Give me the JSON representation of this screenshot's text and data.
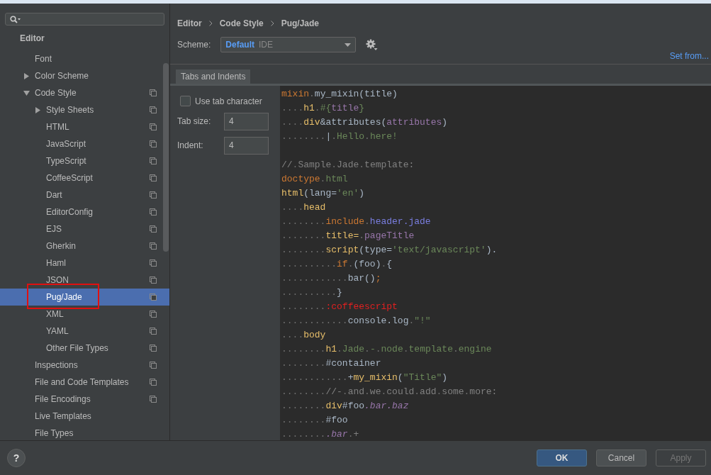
{
  "sidebar": {
    "header": "Editor",
    "items": [
      {
        "label": "Font",
        "selected": false,
        "copy_icon": false,
        "marked": false
      },
      {
        "label": "Color Scheme",
        "selected": false,
        "copy_icon": false,
        "marked": false,
        "expanded": false
      },
      {
        "label": "Code Style",
        "selected": false,
        "copy_icon": true,
        "marked": false,
        "expanded": true,
        "children": [
          {
            "label": "Style Sheets",
            "selected": false,
            "copy_icon": true,
            "marked": false,
            "expanded": false
          },
          {
            "label": "HTML",
            "selected": false,
            "copy_icon": true,
            "marked": false
          },
          {
            "label": "JavaScript",
            "selected": false,
            "copy_icon": true,
            "marked": false
          },
          {
            "label": "TypeScript",
            "selected": false,
            "copy_icon": true,
            "marked": false
          },
          {
            "label": "CoffeeScript",
            "selected": false,
            "copy_icon": true,
            "marked": false
          },
          {
            "label": "Dart",
            "selected": false,
            "copy_icon": true,
            "marked": false
          },
          {
            "label": "EditorConfig",
            "selected": false,
            "copy_icon": true,
            "marked": false
          },
          {
            "label": "EJS",
            "selected": false,
            "copy_icon": true,
            "marked": false
          },
          {
            "label": "Gherkin",
            "selected": false,
            "copy_icon": true,
            "marked": false
          },
          {
            "label": "Haml",
            "selected": false,
            "copy_icon": true,
            "marked": false
          },
          {
            "label": "JSON",
            "selected": false,
            "copy_icon": true,
            "marked": false
          },
          {
            "label": "Pug/Jade",
            "selected": true,
            "copy_icon": true,
            "marked": true
          },
          {
            "label": "XML",
            "selected": false,
            "copy_icon": true,
            "marked": false
          },
          {
            "label": "YAML",
            "selected": false,
            "copy_icon": true,
            "marked": false
          },
          {
            "label": "Other File Types",
            "selected": false,
            "copy_icon": true,
            "marked": false
          }
        ]
      },
      {
        "label": "Inspections",
        "selected": false,
        "copy_icon": true,
        "marked": false
      },
      {
        "label": "File and Code Templates",
        "selected": false,
        "copy_icon": true,
        "marked": false
      },
      {
        "label": "File Encodings",
        "selected": false,
        "copy_icon": true,
        "marked": false
      },
      {
        "label": "Live Templates",
        "selected": false,
        "copy_icon": false,
        "marked": false
      },
      {
        "label": "File Types",
        "selected": false,
        "copy_icon": false,
        "marked": false
      }
    ]
  },
  "breadcrumb": [
    "Editor",
    "Code Style",
    "Pug/Jade"
  ],
  "scheme": {
    "label": "Scheme:",
    "name": "Default",
    "scope": "IDE"
  },
  "set_from": "Set from...",
  "tabs": [
    {
      "label": "Tabs and Indents",
      "selected": true
    }
  ],
  "options": {
    "use_tab": {
      "label": "Use tab character",
      "checked": false
    },
    "fields": [
      {
        "label": "Tab size:",
        "value": "4"
      },
      {
        "label": "Indent:",
        "value": "4"
      }
    ]
  },
  "code": [
    {
      "kind": "code",
      "tokens": [
        {
          "kind": "kw",
          "text": "mixin"
        },
        {
          "kind": "ws",
          "text": "."
        },
        {
          "kind": "plain",
          "text": "my_mixin(title)"
        }
      ]
    },
    {
      "kind": "code",
      "tokens": [
        {
          "kind": "ws",
          "text": "...."
        },
        {
          "kind": "tag",
          "text": "h1"
        },
        {
          "kind": "ws",
          "text": "."
        },
        {
          "kind": "str",
          "text": "#{"
        },
        {
          "kind": "var",
          "text": "title"
        },
        {
          "kind": "str",
          "text": "}"
        }
      ]
    },
    {
      "kind": "code",
      "tokens": [
        {
          "kind": "ws",
          "text": "...."
        },
        {
          "kind": "tag",
          "text": "div"
        },
        {
          "kind": "plain",
          "text": "&attributes("
        },
        {
          "kind": "var",
          "text": "attributes"
        },
        {
          "kind": "plain",
          "text": ")"
        }
      ]
    },
    {
      "kind": "code",
      "tokens": [
        {
          "kind": "ws",
          "text": "........"
        },
        {
          "kind": "plain",
          "text": "|"
        },
        {
          "kind": "ws",
          "text": "."
        },
        {
          "kind": "str",
          "text": "Hello"
        },
        {
          "kind": "ws",
          "text": "."
        },
        {
          "kind": "str",
          "text": "here!"
        }
      ]
    },
    {
      "kind": "blank"
    },
    {
      "kind": "code",
      "tokens": [
        {
          "kind": "comment",
          "text": "//"
        },
        {
          "kind": "ws",
          "text": "."
        },
        {
          "kind": "comment",
          "text": "Sample"
        },
        {
          "kind": "ws",
          "text": "."
        },
        {
          "kind": "comment",
          "text": "Jade"
        },
        {
          "kind": "ws",
          "text": "."
        },
        {
          "kind": "comment",
          "text": "template:"
        }
      ]
    },
    {
      "kind": "code",
      "tokens": [
        {
          "kind": "kw",
          "text": "doctype"
        },
        {
          "kind": "ws",
          "text": "."
        },
        {
          "kind": "str",
          "text": "html"
        }
      ]
    },
    {
      "kind": "code",
      "tokens": [
        {
          "kind": "tag",
          "text": "html"
        },
        {
          "kind": "plain",
          "text": "(lang="
        },
        {
          "kind": "str",
          "text": "'en'"
        },
        {
          "kind": "plain",
          "text": ")"
        }
      ]
    },
    {
      "kind": "code",
      "tokens": [
        {
          "kind": "ws",
          "text": "...."
        },
        {
          "kind": "tag",
          "text": "head"
        }
      ]
    },
    {
      "kind": "code",
      "tokens": [
        {
          "kind": "ws",
          "text": "........"
        },
        {
          "kind": "kw",
          "text": "include"
        },
        {
          "kind": "ws",
          "text": "."
        },
        {
          "kind": "file",
          "text": "header.jade"
        }
      ]
    },
    {
      "kind": "code",
      "tokens": [
        {
          "kind": "ws",
          "text": "........"
        },
        {
          "kind": "tag",
          "text": "title="
        },
        {
          "kind": "ws",
          "text": "."
        },
        {
          "kind": "var",
          "text": "pageTitle"
        }
      ]
    },
    {
      "kind": "code",
      "tokens": [
        {
          "kind": "ws",
          "text": "........"
        },
        {
          "kind": "tag",
          "text": "script"
        },
        {
          "kind": "plain",
          "text": "(type="
        },
        {
          "kind": "str",
          "text": "'text/javascript'"
        },
        {
          "kind": "plain",
          "text": ")."
        }
      ]
    },
    {
      "kind": "code",
      "tokens": [
        {
          "kind": "ws",
          "text": ".........."
        },
        {
          "kind": "kw",
          "text": "if"
        },
        {
          "kind": "ws",
          "text": "."
        },
        {
          "kind": "plain",
          "text": "(foo)"
        },
        {
          "kind": "ws",
          "text": "."
        },
        {
          "kind": "plain",
          "text": "{"
        }
      ]
    },
    {
      "kind": "code",
      "tokens": [
        {
          "kind": "ws",
          "text": "............"
        },
        {
          "kind": "plain",
          "text": "bar()"
        },
        {
          "kind": "kw",
          "text": ";"
        }
      ]
    },
    {
      "kind": "code",
      "tokens": [
        {
          "kind": "ws",
          "text": ".........."
        },
        {
          "kind": "plain",
          "text": "}"
        }
      ]
    },
    {
      "kind": "code",
      "tokens": [
        {
          "kind": "ws",
          "text": "........"
        },
        {
          "kind": "filter",
          "text": ":coffeescript"
        }
      ]
    },
    {
      "kind": "code",
      "tokens": [
        {
          "kind": "ws",
          "text": "............"
        },
        {
          "kind": "plain",
          "text": "console.log"
        },
        {
          "kind": "ws",
          "text": "."
        },
        {
          "kind": "str",
          "text": "\"!\""
        }
      ]
    },
    {
      "kind": "code",
      "tokens": [
        {
          "kind": "ws",
          "text": "...."
        },
        {
          "kind": "tag",
          "text": "body"
        }
      ]
    },
    {
      "kind": "code",
      "tokens": [
        {
          "kind": "ws",
          "text": "........"
        },
        {
          "kind": "tag",
          "text": "h1"
        },
        {
          "kind": "ws",
          "text": "."
        },
        {
          "kind": "str",
          "text": "Jade"
        },
        {
          "kind": "ws",
          "text": "."
        },
        {
          "kind": "str",
          "text": "-"
        },
        {
          "kind": "ws",
          "text": "."
        },
        {
          "kind": "str",
          "text": "node"
        },
        {
          "kind": "ws",
          "text": "."
        },
        {
          "kind": "str",
          "text": "template"
        },
        {
          "kind": "ws",
          "text": "."
        },
        {
          "kind": "str",
          "text": "engine"
        }
      ]
    },
    {
      "kind": "code",
      "tokens": [
        {
          "kind": "ws",
          "text": "........"
        },
        {
          "kind": "plain",
          "text": "#container"
        }
      ]
    },
    {
      "kind": "code",
      "tokens": [
        {
          "kind": "ws",
          "text": "............"
        },
        {
          "kind": "plain",
          "text": "+"
        },
        {
          "kind": "tag",
          "text": "my_mixin"
        },
        {
          "kind": "plain",
          "text": "("
        },
        {
          "kind": "str",
          "text": "\"Title\""
        },
        {
          "kind": "plain",
          "text": ")"
        }
      ]
    },
    {
      "kind": "code",
      "tokens": [
        {
          "kind": "ws",
          "text": "........"
        },
        {
          "kind": "comment",
          "text": "//-"
        },
        {
          "kind": "ws",
          "text": "."
        },
        {
          "kind": "comment",
          "text": "and"
        },
        {
          "kind": "ws",
          "text": "."
        },
        {
          "kind": "comment",
          "text": "we"
        },
        {
          "kind": "ws",
          "text": "."
        },
        {
          "kind": "comment",
          "text": "could"
        },
        {
          "kind": "ws",
          "text": "."
        },
        {
          "kind": "comment",
          "text": "add"
        },
        {
          "kind": "ws",
          "text": "."
        },
        {
          "kind": "comment",
          "text": "some"
        },
        {
          "kind": "ws",
          "text": "."
        },
        {
          "kind": "comment",
          "text": "more:"
        }
      ]
    },
    {
      "kind": "code",
      "tokens": [
        {
          "kind": "ws",
          "text": "........"
        },
        {
          "kind": "tag",
          "text": "div"
        },
        {
          "kind": "plain",
          "text": "#foo"
        },
        {
          "kind": "class",
          "text": ".bar.baz"
        }
      ]
    },
    {
      "kind": "code",
      "tokens": [
        {
          "kind": "ws",
          "text": "........"
        },
        {
          "kind": "plain",
          "text": "#foo"
        }
      ]
    },
    {
      "kind": "code",
      "tokens": [
        {
          "kind": "ws",
          "text": "........"
        },
        {
          "kind": "class",
          "text": ".bar"
        },
        {
          "kind": "ws",
          "text": "."
        },
        {
          "kind": "comment",
          "text": "+"
        }
      ]
    }
  ],
  "help": "?",
  "buttons": [
    {
      "label": "OK",
      "kind": "primary"
    },
    {
      "label": "Cancel",
      "kind": "normal"
    },
    {
      "label": "Apply",
      "kind": "disabled"
    }
  ]
}
